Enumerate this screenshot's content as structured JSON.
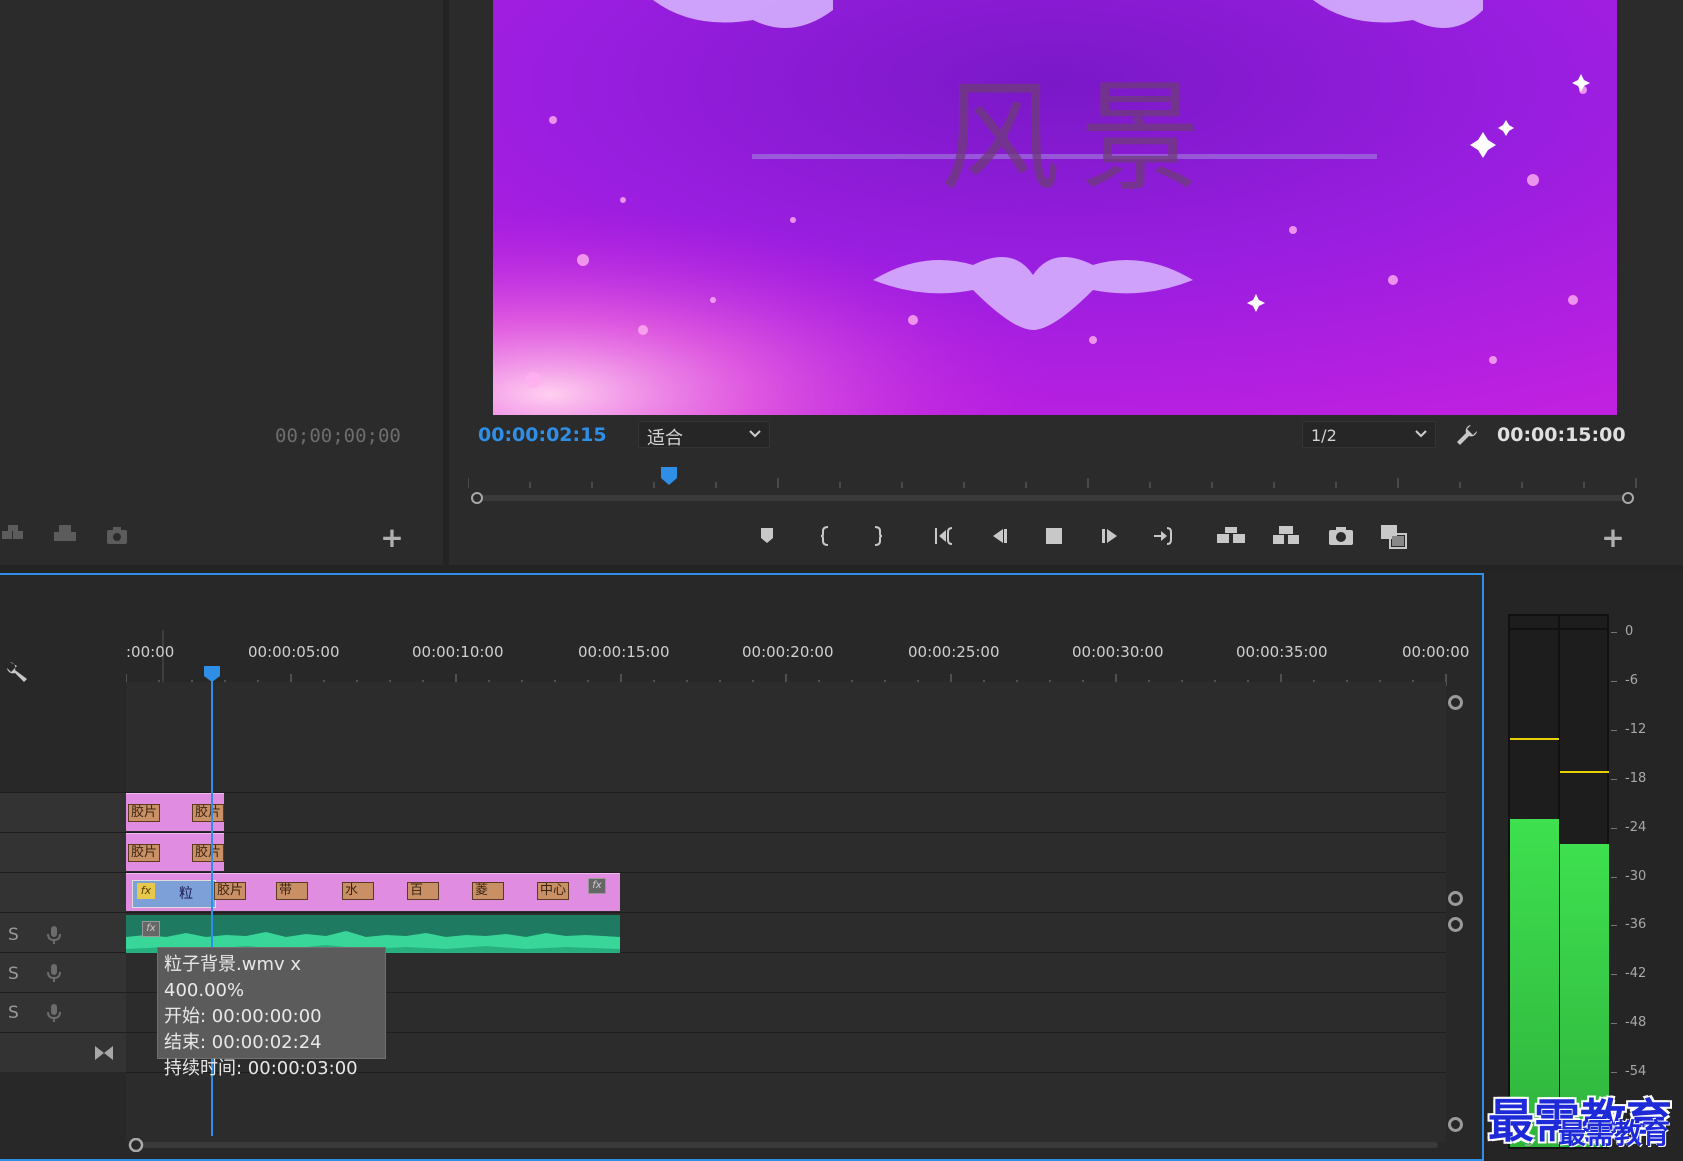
{
  "source_monitor": {
    "timecode": "00;00;00;00",
    "add_label": "+"
  },
  "program_monitor": {
    "video_title": "风景",
    "current_timecode": "00:00:02:15",
    "fit_option": "适合",
    "resolution": "1/2",
    "duration_timecode": "00:00:15:00",
    "add_label": "+",
    "transport_icons": [
      "marker-icon",
      "mark-in-icon",
      "mark-out-icon",
      "go-to-in-icon",
      "step-back-icon",
      "stop-icon",
      "step-forward-icon",
      "go-to-out-icon",
      "lift-icon",
      "extract-icon",
      "export-frame-icon",
      "comparison-view-icon"
    ]
  },
  "timeline": {
    "ruler_labels": [
      ":00:00",
      "00:00:05:00",
      "00:00:10:00",
      "00:00:15:00",
      "00:00:20:00",
      "00:00:25:00",
      "00:00:30:00",
      "00:00:35:00",
      "00:00:00"
    ],
    "audio_tracks": [
      {
        "label": "S"
      },
      {
        "label": "S"
      },
      {
        "label": "S"
      }
    ],
    "clips_v3": [
      "胶片",
      "胶片"
    ],
    "clips_v2": [
      "胶片",
      "胶片"
    ],
    "clips_v1": {
      "first_label": "粒",
      "fx": "fx",
      "labels": [
        "胶片",
        "带",
        "水",
        "百",
        "菱",
        "中心"
      ]
    },
    "tooltip": {
      "line1": "粒子背景.wmv x 400.00%",
      "line2": "开始: 00:00:00:00",
      "line3": "结束: 00:00:02:24",
      "line4": "持续时间: 00:00:03:00"
    }
  },
  "audio_meter": {
    "db_labels": [
      "0",
      "-6",
      "-12",
      "-18",
      "-24",
      "-30",
      "-36",
      "-42",
      "-48",
      "-54"
    ],
    "left_level_db": -23,
    "right_level_db": -26,
    "left_peak_db": -13,
    "right_peak_db": -17,
    "solo_labels": [
      "S",
      "S"
    ]
  },
  "watermark": "最需教育",
  "colors": {
    "accent": "#2f8fe6",
    "clip_pink": "#e08ce0",
    "audio_clip": "#1f7a62",
    "meter_green": "#3ee04f"
  }
}
